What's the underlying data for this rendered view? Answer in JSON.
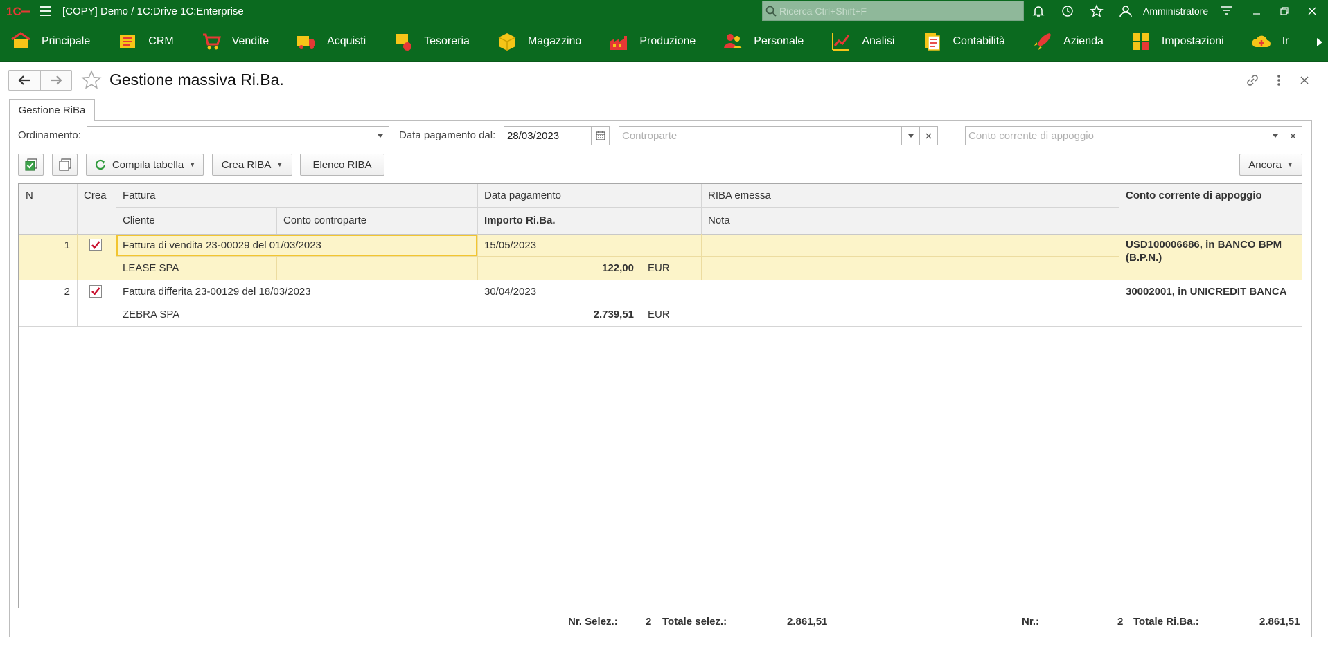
{
  "window": {
    "title": "[COPY] Demo / 1C:Drive 1C:Enterprise",
    "search_placeholder": "Ricerca Ctrl+Shift+F",
    "user": "Amministratore"
  },
  "sections": [
    {
      "label": "Principale",
      "icon": "home-icon",
      "color": "#f5c518"
    },
    {
      "label": "CRM",
      "icon": "crm-icon",
      "color": "#f5c518"
    },
    {
      "label": "Vendite",
      "icon": "cart-icon",
      "color": "#e53935"
    },
    {
      "label": "Acquisti",
      "icon": "truck-icon",
      "color": "#e53935"
    },
    {
      "label": "Tesoreria",
      "icon": "treasury-icon",
      "color": "#f5c518"
    },
    {
      "label": "Magazzino",
      "icon": "box-icon",
      "color": "#f5c518"
    },
    {
      "label": "Produzione",
      "icon": "factory-icon",
      "color": "#e53935"
    },
    {
      "label": "Personale",
      "icon": "people-icon",
      "color": "#e53935"
    },
    {
      "label": "Analisi",
      "icon": "chart-icon",
      "color": "#e53935"
    },
    {
      "label": "Contabilità",
      "icon": "ledger-icon",
      "color": "#f5c518"
    },
    {
      "label": "Azienda",
      "icon": "rocket-icon",
      "color": "#e53935"
    },
    {
      "label": "Impostazioni",
      "icon": "settings-blocks-icon",
      "color": "#f5c518"
    },
    {
      "label": "Ir",
      "icon": "cloud-icon",
      "color": "#f5c518"
    }
  ],
  "form": {
    "title": "Gestione massiva Ri.Ba.",
    "tab": "Gestione RiBa"
  },
  "filters": {
    "ordinamento_label": "Ordinamento:",
    "ordinamento_value": "",
    "data_label": "Data pagamento dal:",
    "data_value": "28/03/2023",
    "controparte_placeholder": "Controparte",
    "conto_placeholder": "Conto corrente di appoggio"
  },
  "toolbar": {
    "compila": "Compila tabella",
    "crea": "Crea RIBA",
    "elenco": "Elenco RIBA",
    "ancora": "Ancora"
  },
  "table": {
    "headers": {
      "n": "N",
      "crea": "Crea",
      "fattura": "Fattura",
      "data_pagamento": "Data pagamento",
      "riba_emessa": "RIBA emessa",
      "conto": "Conto corrente di appoggio",
      "cliente": "Cliente",
      "conto_controparte": "Conto controparte",
      "importo": "Importo Ri.Ba.",
      "nota": "Nota"
    },
    "rows": [
      {
        "n": "1",
        "crea": true,
        "fattura": "Fattura di vendita 23-00029 del 01/03/2023",
        "data_pagamento": "15/05/2023",
        "riba_emessa": "",
        "conto": "USD100006686, in BANCO BPM (B.P.N.)",
        "cliente": "LEASE SPA",
        "conto_controparte": "",
        "importo": "122,00",
        "valuta": "EUR",
        "nota": ""
      },
      {
        "n": "2",
        "crea": true,
        "fattura": "Fattura differita 23-00129 del 18/03/2023",
        "data_pagamento": "30/04/2023",
        "riba_emessa": "",
        "conto": "30002001, in UNICREDIT BANCA",
        "cliente": "ZEBRA SPA",
        "conto_controparte": "",
        "importo": "2.739,51",
        "valuta": "EUR",
        "nota": ""
      }
    ]
  },
  "footer": {
    "nr_selez_label": "Nr. Selez.:",
    "nr_selez": "2",
    "totale_selez_label": "Totale selez.:",
    "totale_selez": "2.861,51",
    "nr_label": "Nr.:",
    "nr": "2",
    "totale_riba_label": "Totale Ri.Ba.:",
    "totale_riba": "2.861,51"
  }
}
